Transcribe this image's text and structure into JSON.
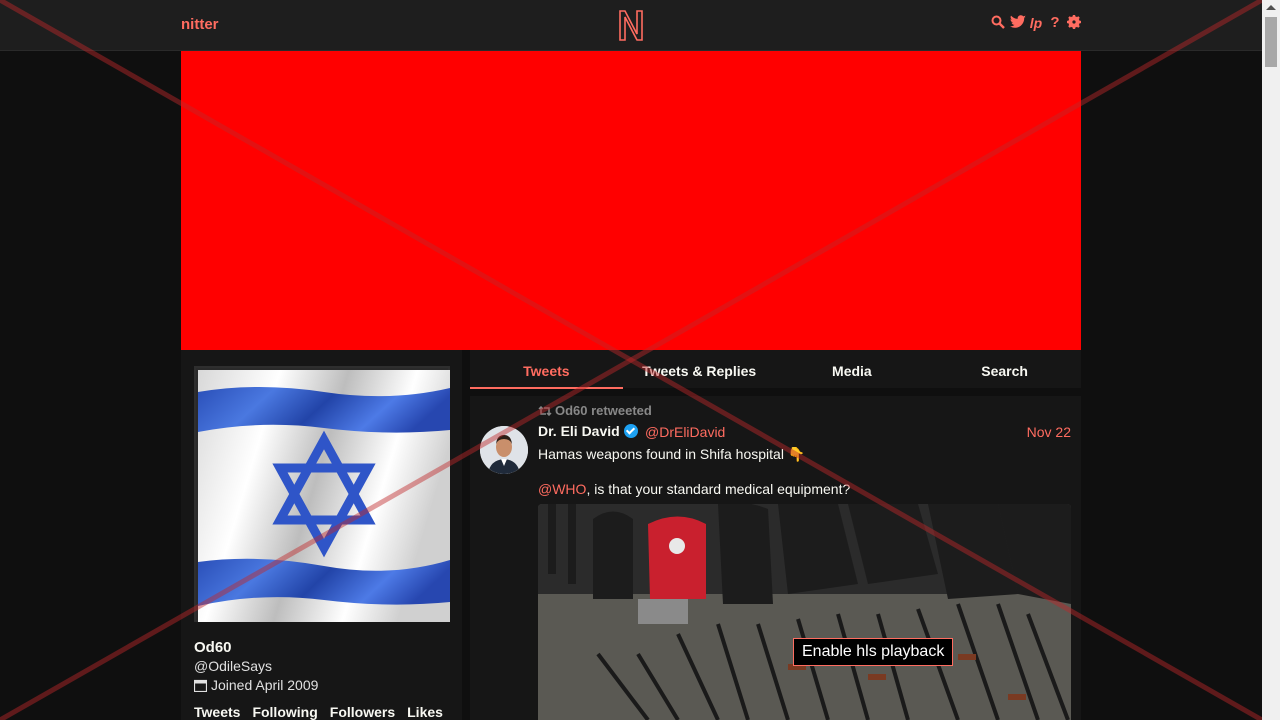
{
  "nav": {
    "brand": "nitter",
    "icons": [
      "search-icon",
      "twitter-bird-icon",
      "rss-icon",
      "help-icon",
      "gear-icon"
    ],
    "accent": "#ff6c60"
  },
  "banner": {
    "color": "#ff0000"
  },
  "profile": {
    "fullname": "Od60",
    "username": "@OdileSays",
    "joined": "Joined April 2009",
    "stats": [
      "Tweets",
      "Following",
      "Followers",
      "Likes"
    ]
  },
  "tabs": [
    {
      "label": "Tweets",
      "active": true
    },
    {
      "label": "Tweets & Replies",
      "active": false
    },
    {
      "label": "Media",
      "active": false
    },
    {
      "label": "Search",
      "active": false
    }
  ],
  "tweet": {
    "retweet_header": "Od60 retweeted",
    "fullname": "Dr. Eli David",
    "handle": "@DrEliDavid",
    "date": "Nov 22",
    "text": "Hamas weapons found in Shifa hospital 👇",
    "mention": "@WHO",
    "text2": ", is that your standard medical equipment?",
    "hls_button": "Enable hls playback"
  }
}
